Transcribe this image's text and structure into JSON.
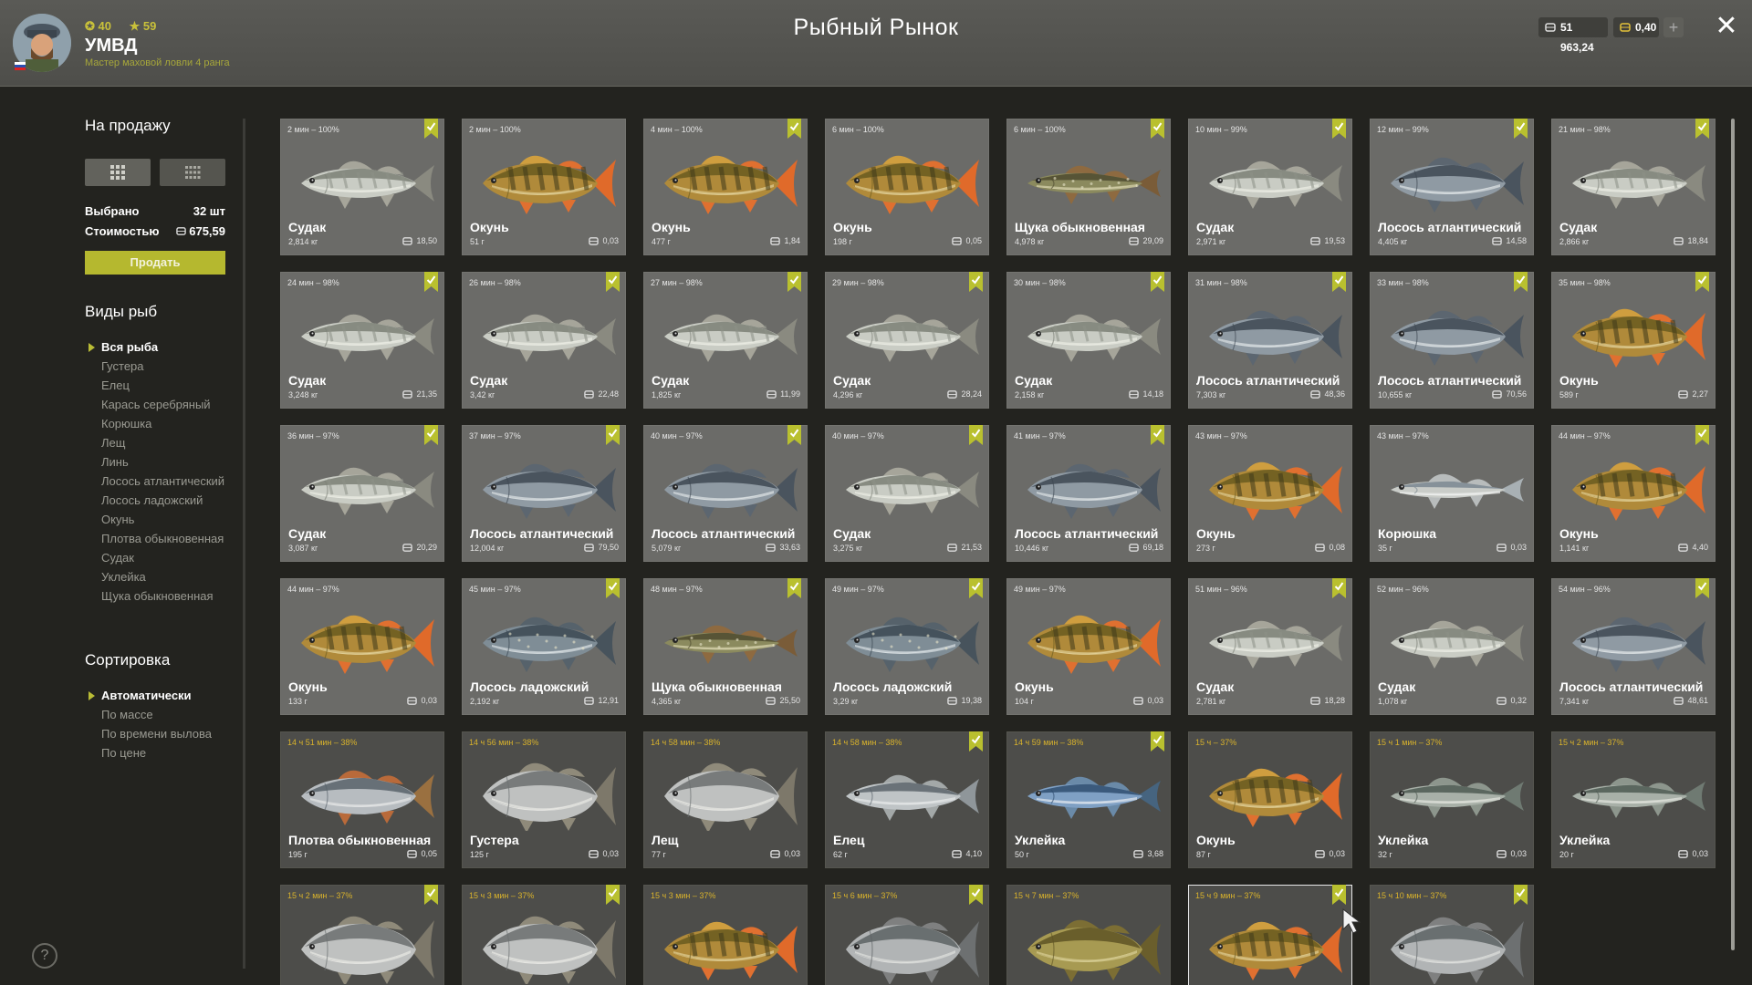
{
  "header": {
    "title": "Рыбный Рынок",
    "stat_level": "40",
    "stat_stars": "59",
    "username": "УМВД",
    "rank": "Мастер маховой ловли 4 ранга",
    "silver": "51 963,24",
    "gold": "0,40"
  },
  "sidebar": {
    "for_sale_title": "На продажу",
    "selected_label": "Выбрано",
    "selected_value": "32 шт",
    "cost_label": "Стоимостью",
    "cost_value": "675,59",
    "sell_button": "Продать",
    "species_title": "Виды рыб",
    "species": [
      "Вся рыба",
      "Густера",
      "Елец",
      "Карась серебряный",
      "Корюшка",
      "Лещ",
      "Линь",
      "Лосось атлантический",
      "Лосось ладожский",
      "Окунь",
      "Плотва обыкновенная",
      "Судак",
      "Уклейка",
      "Щука обыкновенная"
    ],
    "species_active": 0,
    "sort_title": "Сортировка",
    "sort": [
      "Автоматически",
      "По массе",
      "По времени вылова",
      "По цене"
    ],
    "sort_active": 0,
    "help": "?"
  },
  "colors": {
    "accent": "#b5b82f",
    "time_fresh": "#e5e5e5",
    "time_old": "#d8b22c"
  },
  "cards": [
    {
      "time": "2 мин – 100%",
      "name": "Судак",
      "weight": "2,814 кг",
      "price": "18,50",
      "fish": "zander",
      "marked": true
    },
    {
      "time": "2 мин – 100%",
      "name": "Окунь",
      "weight": "51 г",
      "price": "0,03",
      "fish": "perch",
      "marked": false
    },
    {
      "time": "4 мин – 100%",
      "name": "Окунь",
      "weight": "477 г",
      "price": "1,84",
      "fish": "perch",
      "marked": true
    },
    {
      "time": "6 мин – 100%",
      "name": "Окунь",
      "weight": "198 г",
      "price": "0,05",
      "fish": "perch",
      "marked": false
    },
    {
      "time": "6 мин – 100%",
      "name": "Щука обыкновенная",
      "weight": "4,978 кг",
      "price": "29,09",
      "fish": "pike",
      "marked": true
    },
    {
      "time": "10 мин – 99%",
      "name": "Судак",
      "weight": "2,971 кг",
      "price": "19,53",
      "fish": "zander",
      "marked": true
    },
    {
      "time": "12 мин – 99%",
      "name": "Лосось атлантический",
      "weight": "4,405 кг",
      "price": "14,58",
      "fish": "salmon",
      "marked": true
    },
    {
      "time": "21 мин – 98%",
      "name": "Судак",
      "weight": "2,866 кг",
      "price": "18,84",
      "fish": "zander",
      "marked": true
    },
    {
      "time": "24 мин – 98%",
      "name": "Судак",
      "weight": "3,248 кг",
      "price": "21,35",
      "fish": "zander",
      "marked": true
    },
    {
      "time": "26 мин – 98%",
      "name": "Судак",
      "weight": "3,42 кг",
      "price": "22,48",
      "fish": "zander",
      "marked": true
    },
    {
      "time": "27 мин – 98%",
      "name": "Судак",
      "weight": "1,825 кг",
      "price": "11,99",
      "fish": "zander",
      "marked": true
    },
    {
      "time": "29 мин – 98%",
      "name": "Судак",
      "weight": "4,296 кг",
      "price": "28,24",
      "fish": "zander",
      "marked": true
    },
    {
      "time": "30 мин – 98%",
      "name": "Судак",
      "weight": "2,158 кг",
      "price": "14,18",
      "fish": "zander",
      "marked": true
    },
    {
      "time": "31 мин – 98%",
      "name": "Лосось атлантический",
      "weight": "7,303 кг",
      "price": "48,36",
      "fish": "salmon",
      "marked": true
    },
    {
      "time": "33 мин – 98%",
      "name": "Лосось атлантический",
      "weight": "10,655 кг",
      "price": "70,56",
      "fish": "salmon",
      "marked": true
    },
    {
      "time": "35 мин – 98%",
      "name": "Окунь",
      "weight": "589 г",
      "price": "2,27",
      "fish": "perch",
      "marked": true
    },
    {
      "time": "36 мин – 97%",
      "name": "Судак",
      "weight": "3,087 кг",
      "price": "20,29",
      "fish": "zander",
      "marked": true
    },
    {
      "time": "37 мин – 97%",
      "name": "Лосось атлантический",
      "weight": "12,004 кг",
      "price": "79,50",
      "fish": "salmon",
      "marked": true
    },
    {
      "time": "40 мин – 97%",
      "name": "Лосось атлантический",
      "weight": "5,079 кг",
      "price": "33,63",
      "fish": "salmon",
      "marked": true
    },
    {
      "time": "40 мин – 97%",
      "name": "Судак",
      "weight": "3,275 кг",
      "price": "21,53",
      "fish": "zander",
      "marked": true
    },
    {
      "time": "41 мин – 97%",
      "name": "Лосось атлантический",
      "weight": "10,446 кг",
      "price": "69,18",
      "fish": "salmon",
      "marked": true
    },
    {
      "time": "43 мин – 97%",
      "name": "Окунь",
      "weight": "273 г",
      "price": "0,08",
      "fish": "perch",
      "marked": false
    },
    {
      "time": "43 мин – 97%",
      "name": "Корюшка",
      "weight": "35 г",
      "price": "0,03",
      "fish": "smelt",
      "marked": false
    },
    {
      "time": "44 мин – 97%",
      "name": "Окунь",
      "weight": "1,141 кг",
      "price": "4,40",
      "fish": "perch",
      "marked": true
    },
    {
      "time": "44 мин – 97%",
      "name": "Окунь",
      "weight": "133 г",
      "price": "0,03",
      "fish": "perch",
      "marked": false
    },
    {
      "time": "45 мин – 97%",
      "name": "Лосось ладожский",
      "weight": "2,192 кг",
      "price": "12,91",
      "fish": "trout",
      "marked": true
    },
    {
      "time": "48 мин – 97%",
      "name": "Щука обыкновенная",
      "weight": "4,365 кг",
      "price": "25,50",
      "fish": "pike",
      "marked": true
    },
    {
      "time": "49 мин – 97%",
      "name": "Лосось ладожский",
      "weight": "3,29 кг",
      "price": "19,38",
      "fish": "trout",
      "marked": true
    },
    {
      "time": "49 мин – 97%",
      "name": "Окунь",
      "weight": "104 г",
      "price": "0,03",
      "fish": "perch",
      "marked": false
    },
    {
      "time": "51 мин – 96%",
      "name": "Судак",
      "weight": "2,781 кг",
      "price": "18,28",
      "fish": "zander",
      "marked": true
    },
    {
      "time": "52 мин – 96%",
      "name": "Судак",
      "weight": "1,078 кг",
      "price": "0,32",
      "fish": "zander",
      "marked": false
    },
    {
      "time": "54 мин – 96%",
      "name": "Лосось атлантический",
      "weight": "7,341 кг",
      "price": "48,61",
      "fish": "salmon",
      "marked": true
    },
    {
      "time": "14 ч 51 мин – 38%",
      "name": "Плотва обыкновенная",
      "weight": "195 г",
      "price": "0,05",
      "fish": "roach",
      "marked": false,
      "dim": true
    },
    {
      "time": "14 ч 56 мин – 38%",
      "name": "Густера",
      "weight": "125 г",
      "price": "0,03",
      "fish": "bream",
      "marked": false,
      "dim": true
    },
    {
      "time": "14 ч 58 мин – 38%",
      "name": "Лещ",
      "weight": "77 г",
      "price": "0,03",
      "fish": "bream",
      "marked": false,
      "dim": true
    },
    {
      "time": "14 ч 58 мин – 38%",
      "name": "Елец",
      "weight": "62 г",
      "price": "4,10",
      "fish": "dace",
      "marked": true,
      "dim": true
    },
    {
      "time": "14 ч 59 мин – 38%",
      "name": "Уклейка",
      "weight": "50 г",
      "price": "3,68",
      "fish": "bleak",
      "marked": true,
      "dim": true
    },
    {
      "time": "15 ч – 37%",
      "name": "Окунь",
      "weight": "87 г",
      "price": "0,03",
      "fish": "perch",
      "marked": false,
      "dim": true
    },
    {
      "time": "15 ч 1 мин – 37%",
      "name": "Уклейка",
      "weight": "32 г",
      "price": "0,03",
      "fish": "bleak2",
      "marked": false,
      "dim": true
    },
    {
      "time": "15 ч 2 мин – 37%",
      "name": "Уклейка",
      "weight": "20 г",
      "price": "0,03",
      "fish": "bleak2",
      "marked": false,
      "dim": true
    },
    {
      "time": "15 ч 2 мин – 37%",
      "name": "",
      "weight": "",
      "price": "",
      "fish": "bream",
      "marked": true,
      "dim": true
    },
    {
      "time": "15 ч 3 мин – 37%",
      "name": "",
      "weight": "",
      "price": "",
      "fish": "bream",
      "marked": true,
      "dim": true
    },
    {
      "time": "15 ч 3 мин – 37%",
      "name": "",
      "weight": "",
      "price": "",
      "fish": "perch",
      "marked": false,
      "dim": true
    },
    {
      "time": "15 ч 6 мин – 37%",
      "name": "",
      "weight": "",
      "price": "",
      "fish": "carp",
      "marked": true,
      "dim": true
    },
    {
      "time": "15 ч 7 мин – 37%",
      "name": "",
      "weight": "",
      "price": "",
      "fish": "tench",
      "marked": false,
      "dim": true
    },
    {
      "time": "15 ч 9 мин – 37%",
      "name": "",
      "weight": "",
      "price": "",
      "fish": "perch",
      "marked": true,
      "dim": true,
      "highlight": true
    },
    {
      "time": "15 ч 10 мин – 37%",
      "name": "",
      "weight": "",
      "price": "",
      "fish": "carp",
      "marked": true,
      "dim": true
    }
  ]
}
